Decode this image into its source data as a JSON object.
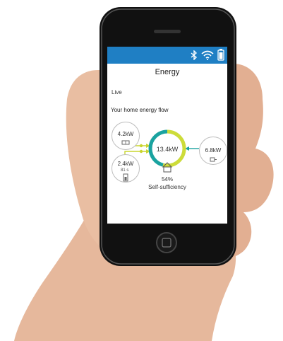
{
  "colors": {
    "header_blue": "#1f7fc4",
    "ring_yellow": "#cddc39",
    "ring_teal": "#1aa3a0",
    "arrow_teal": "#1aa3a0",
    "arrow_yellow": "#c9d52e"
  },
  "status_bar": {
    "icons": [
      "bluetooth-icon",
      "wifi-icon",
      "battery-icon"
    ]
  },
  "app": {
    "title": "Energy",
    "tab": "Live",
    "section_title": "Your home energy flow"
  },
  "flow": {
    "solar": {
      "value": "4.2kW",
      "icon": "solar-panel-icon"
    },
    "battery": {
      "value": "2.4kW",
      "sub": "81 s",
      "icon": "battery-storage-icon"
    },
    "grid": {
      "value": "6.8kW",
      "icon": "grid-plug-icon"
    },
    "home": {
      "value": "13.4kW",
      "icon": "house-icon",
      "self_sufficiency_percent": "54%",
      "self_sufficiency_label": "Self-sufficiency",
      "ring_fraction_yellow": 0.54
    }
  }
}
